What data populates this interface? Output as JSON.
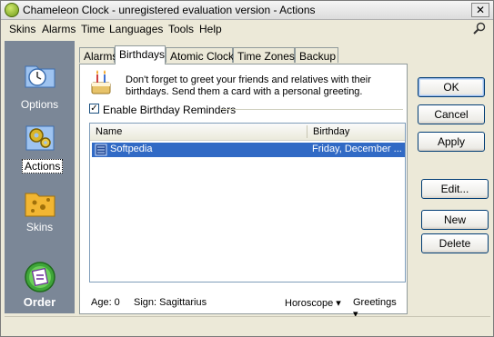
{
  "window": {
    "title": "Chameleon Clock - unregistered evaluation version - Actions",
    "close_label": "✕"
  },
  "menubar": {
    "items": [
      "Skins",
      "Alarms",
      "Time",
      "Languages",
      "Tools",
      "Help"
    ],
    "search_icon": "magnifier-icon"
  },
  "sidebar": {
    "items": [
      {
        "label": "Options",
        "icon": "clock-options-icon"
      },
      {
        "label": "Actions",
        "icon": "gears-icon",
        "selected": true
      },
      {
        "label": "Skins",
        "icon": "skins-folder-icon"
      },
      {
        "label": "Order",
        "icon": "order-cart-icon"
      }
    ]
  },
  "tabs": [
    "Alarms",
    "Birthdays",
    "Atomic Clock",
    "Time Zones",
    "Backup"
  ],
  "active_tab": "Birthdays",
  "birthdays": {
    "message": "Don't forget to greet your friends and relatives with their birthdays. Send them a card with a personal greeting.",
    "enable_label": "Enable Birthday Reminders",
    "enable_checked": true,
    "columns": [
      "Name",
      "Birthday"
    ],
    "rows": [
      {
        "name": "Softpedia",
        "birthday": "Friday, December ..."
      }
    ],
    "age": "Age: 0",
    "sign": "Sign: Sagittarius",
    "horoscope": "Horoscope ▾",
    "greetings": "Greetings ▾"
  },
  "buttons": {
    "ok": "OK",
    "cancel": "Cancel",
    "apply": "Apply",
    "edit": "Edit...",
    "new": "New",
    "delete": "Delete"
  },
  "colors": {
    "sidebar_bg": "#7b8797",
    "selection": "#316ac5",
    "accent_border": "#003c74"
  }
}
